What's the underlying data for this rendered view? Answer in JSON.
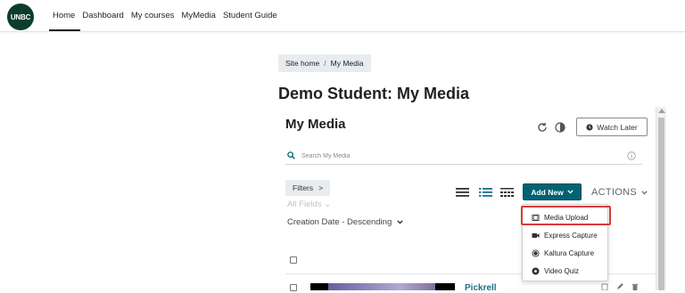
{
  "nav": {
    "logo_text": "UNBC",
    "links": [
      "Home",
      "Dashboard",
      "My courses",
      "MyMedia",
      "Student Guide"
    ],
    "active": "Home"
  },
  "breadcrumb": {
    "items": [
      "Site home",
      "My Media"
    ],
    "separator": "/"
  },
  "page_title": "Demo Student: My Media",
  "my_media": {
    "heading": "My Media",
    "watch_later_label": "Watch Later",
    "search": {
      "placeholder": "Search My Media",
      "value": ""
    },
    "filters_label": "Filters",
    "filters_chevron": ">",
    "all_fields_label": "All Fields",
    "all_fields_chevron": "⌄",
    "sort_label": "Creation Date - Descending",
    "add_new_label": "Add New",
    "actions_label": "ACTIONS",
    "entry": {
      "title": "Pickrell"
    }
  },
  "add_new_menu": {
    "items": [
      {
        "label": "Media Upload",
        "icon": "film-icon",
        "highlighted": true
      },
      {
        "label": "Express Capture",
        "icon": "video-camera-icon"
      },
      {
        "label": "Kaltura Capture",
        "icon": "record-icon"
      },
      {
        "label": "Video Quiz",
        "icon": "quiz-icon"
      }
    ]
  },
  "colors": {
    "accent": "#006272",
    "logo_bg": "#0a3d2c",
    "highlight_border": "#d93a3a",
    "link": "#1f6e8c"
  }
}
